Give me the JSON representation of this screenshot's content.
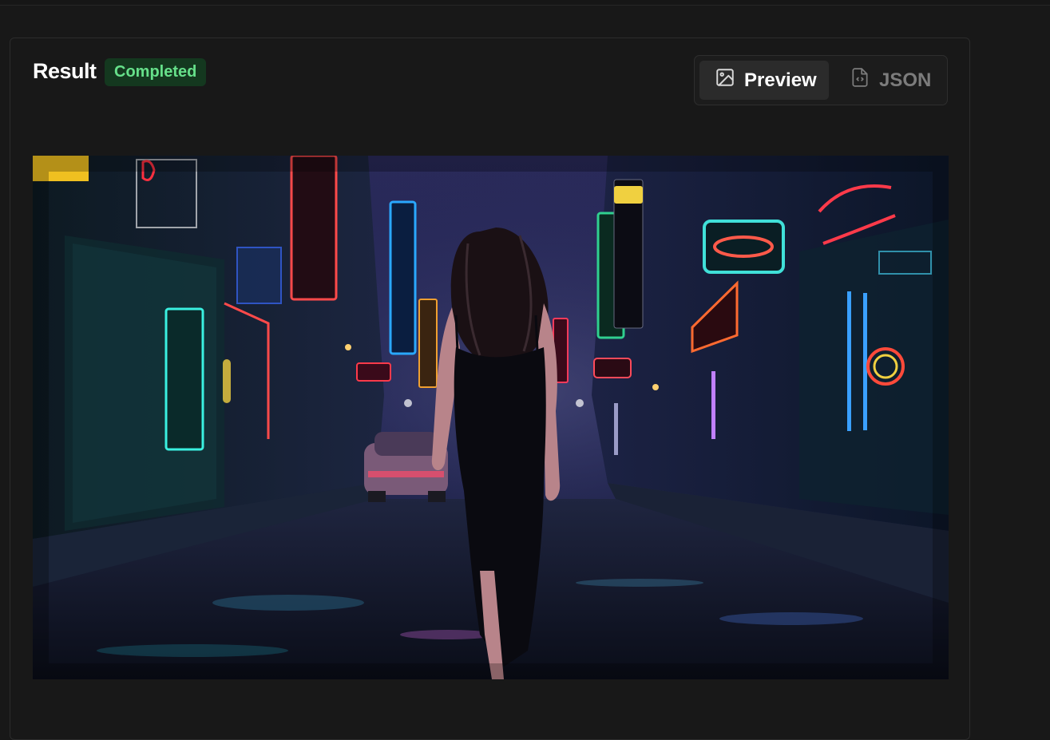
{
  "result": {
    "title": "Result",
    "status": "Completed"
  },
  "view_toggle": {
    "preview_label": "Preview",
    "json_label": "JSON",
    "selected": "Preview"
  },
  "preview": {
    "alt": "Woman in a black dress walking down a neon-lit city street at night"
  },
  "colors": {
    "status_bg": "#14381f",
    "status_text": "#66e08a",
    "background": "#181818"
  },
  "icons": {
    "preview_tab": "image-icon",
    "json_tab": "file-code-icon"
  }
}
